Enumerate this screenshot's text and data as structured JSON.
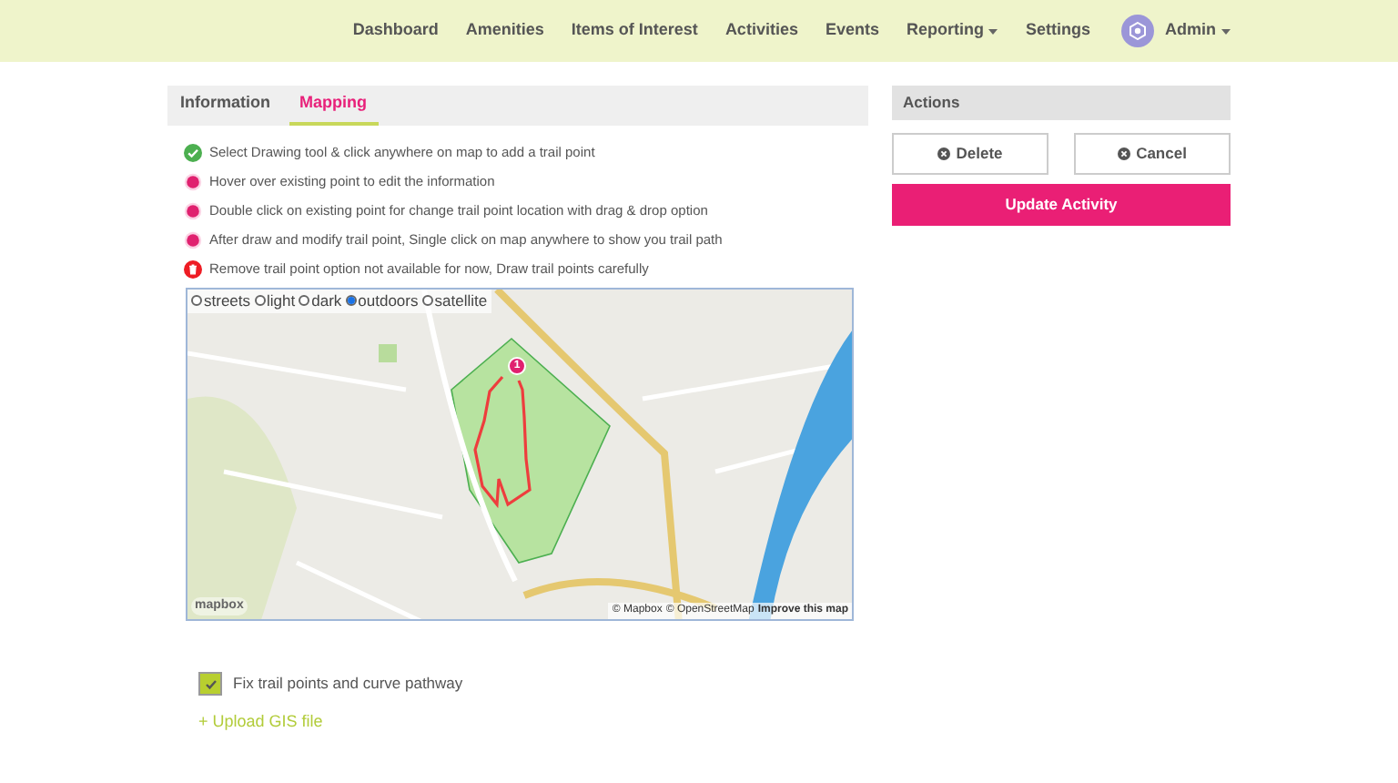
{
  "nav": {
    "items": [
      {
        "label": "Dashboard",
        "dropdown": false
      },
      {
        "label": "Amenities",
        "dropdown": false
      },
      {
        "label": "Items of Interest",
        "dropdown": false
      },
      {
        "label": "Activities",
        "dropdown": false
      },
      {
        "label": "Events",
        "dropdown": false
      },
      {
        "label": "Reporting",
        "dropdown": true
      },
      {
        "label": "Settings",
        "dropdown": false
      }
    ],
    "user": {
      "name": "Admin",
      "dropdown": true
    }
  },
  "tabs": [
    {
      "label": "Information",
      "selected": false
    },
    {
      "label": "Mapping",
      "selected": true
    }
  ],
  "instructions": [
    {
      "kind": "check",
      "text": "Select Drawing tool & click anywhere on map to add a trail point"
    },
    {
      "kind": "dot",
      "text": "Hover over existing point to edit the information"
    },
    {
      "kind": "dot",
      "text": "Double click on existing point for change trail point location with drag & drop option"
    },
    {
      "kind": "dot",
      "text": "After draw and modify trail point, Single click on map anywhere to show you trail path"
    },
    {
      "kind": "trash",
      "text": "Remove trail point option not available for now, Draw trail points carefully"
    }
  ],
  "map": {
    "styles": [
      {
        "label": "streets",
        "selected": false
      },
      {
        "label": "light",
        "selected": false
      },
      {
        "label": "dark",
        "selected": false
      },
      {
        "label": "outdoors",
        "selected": true
      },
      {
        "label": "satellite",
        "selected": false
      }
    ],
    "marker": "1",
    "logo": "mapbox",
    "attribution": [
      {
        "kind": "plain",
        "text": "© Mapbox"
      },
      {
        "kind": "plain",
        "text": "© OpenStreetMap"
      },
      {
        "kind": "bold",
        "text": "Improve this map"
      }
    ]
  },
  "fix_pathway": {
    "label": "Fix trail points and curve pathway",
    "checked": true
  },
  "upload_link": "+ Upload GIS file",
  "actions": {
    "title": "Actions",
    "buttons": [
      {
        "kind": "outline",
        "label": "Delete"
      },
      {
        "kind": "outline",
        "label": "Cancel"
      },
      {
        "kind": "primary",
        "label": "Update Activity"
      }
    ]
  }
}
